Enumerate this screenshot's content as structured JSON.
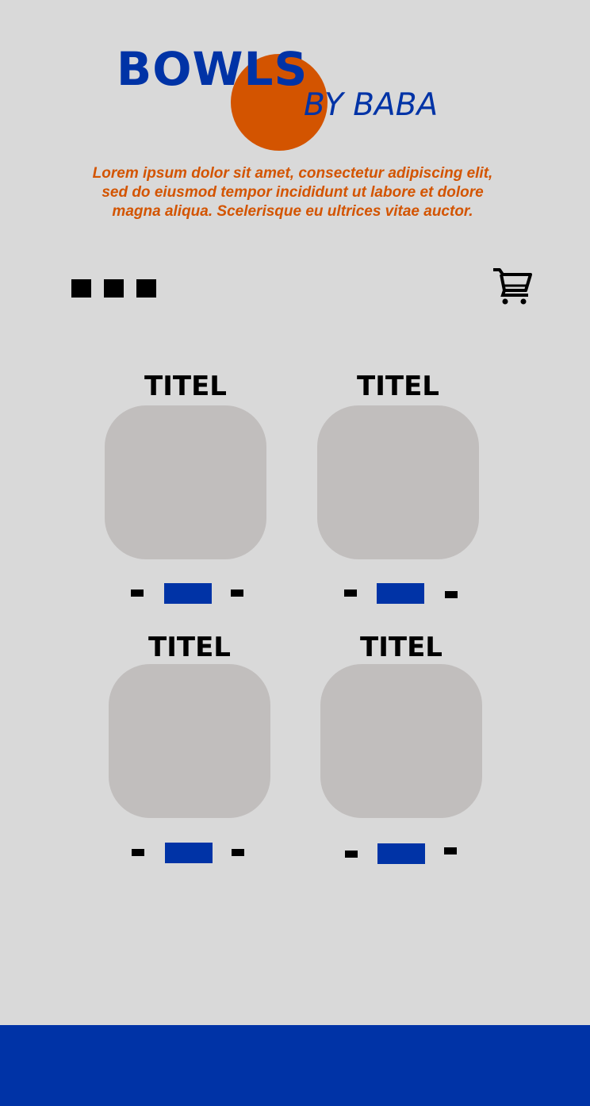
{
  "header": {
    "brand_main": "BOWLS",
    "brand_sub": "BY BABA",
    "tagline": "Lorem ipsum dolor sit amet, consectetur adipiscing elit, sed do eiusmod tempor incididunt ut labore et dolore magna aliqua. Scelerisque eu ultrices vitae auctor."
  },
  "nav": {
    "menu_icon": "menu-squares-icon",
    "cart_icon": "shopping-cart-icon"
  },
  "products": [
    {
      "title": "TITEL"
    },
    {
      "title": "TITEL"
    },
    {
      "title": "TITEL"
    },
    {
      "title": "TITEL"
    }
  ],
  "colors": {
    "brand_blue": "#0033a6",
    "accent_orange": "#d35400",
    "background": "#d9d9d9",
    "card": "#c1bebd"
  }
}
